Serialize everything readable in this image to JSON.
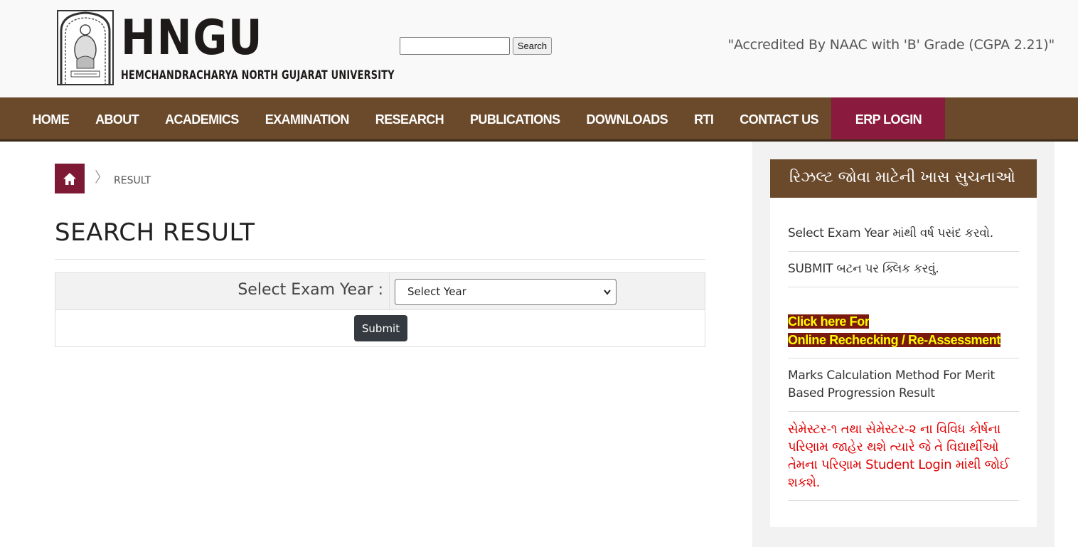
{
  "header": {
    "logo_title": "HNGU",
    "logo_subtitle": "HEMCHANDRACHARYA NORTH GUJARAT UNIVERSITY",
    "search_value": "",
    "search_button": "Search",
    "accreditation": "\"Accredited By NAAC with 'B' Grade (CGPA 2.21)\""
  },
  "nav": {
    "items": [
      {
        "label": "HOME"
      },
      {
        "label": "ABOUT"
      },
      {
        "label": "ACADEMICS"
      },
      {
        "label": "EXAMINATION"
      },
      {
        "label": "RESEARCH"
      },
      {
        "label": "PUBLICATIONS"
      },
      {
        "label": "DOWNLOADS"
      },
      {
        "label": "RTI"
      },
      {
        "label": "CONTACT US"
      }
    ],
    "erp_login": "ERP LOGIN",
    "bar_color": "#6b4a2c",
    "erp_color": "#8b1a3f"
  },
  "breadcrumb": {
    "home_icon": "home-icon",
    "separator": "〉",
    "current": "RESULT"
  },
  "main": {
    "title": "SEARCH RESULT",
    "exam_year_label": "Select Exam Year :",
    "exam_year_selected": "Select Year",
    "submit_label": "Submit"
  },
  "sidebar": {
    "heading": "રિઝલ્ટ જોવા માટેની ખાસ સુચનાઓ",
    "items": [
      {
        "text": "Select Exam Year માંથી વર્ષ પસંદ કરવો."
      },
      {
        "text": "SUBMIT બટન પર ક્લિક કરવું."
      },
      {
        "line1": "Click here For",
        "line2": "Online Rechecking / Re-Assessment"
      },
      {
        "text": "Marks Calculation Method For Merit Based Progression Result"
      },
      {
        "text": "સેમેસ્ટર-૧ તથા સેમેસ્ટર-૨ ના વિવિધ કોર્ષના પરિણામ જાહેર થશે ત્યારે જે તે વિદ્યાર્થીઓ તેમના પરિણામ Student Login માંથી જોઈ શકશે."
      }
    ]
  }
}
